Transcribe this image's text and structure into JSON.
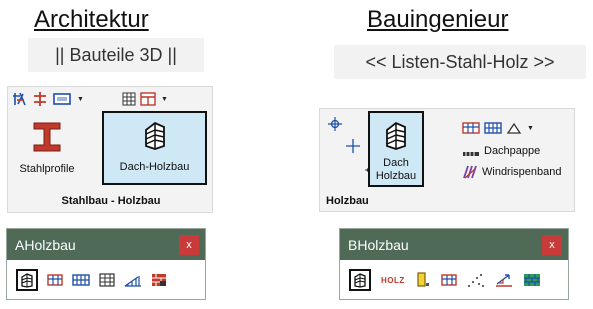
{
  "architektur": {
    "heading": "Architektur",
    "tab_label": "|| Bauteile 3D ||",
    "ribbon": {
      "button_stahlprofile": "Stahlprofile",
      "button_dach_holzbau": "Dach-Holzbau",
      "group_label": "Stahlbau - Holzbau"
    },
    "palette": {
      "title": "AHolzbau",
      "close": "x"
    }
  },
  "bauingenieur": {
    "heading": "Bauingenieur",
    "tab_label": "<< Listen-Stahl-Holz >>",
    "ribbon": {
      "button_dach_holzbau_line1": "Dach",
      "button_dach_holzbau_line2": "Holzbau",
      "dachpappe": "Dachpappe",
      "windrispenband": "Windrispenband",
      "group_label": "Holzbau"
    },
    "palette": {
      "title": "BHolzbau",
      "close": "x",
      "holz_icon_text": "HOLZ"
    }
  },
  "colors": {
    "selected_fill": "#cfe8f5",
    "palette_titlebar": "#4f6b57",
    "close_button": "#c93a3a",
    "icon_red": "#c0392b",
    "icon_blue": "#1f4fa8"
  }
}
